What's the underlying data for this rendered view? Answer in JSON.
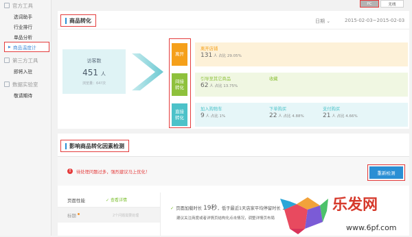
{
  "sidebar": {
    "sections": [
      {
        "title": "官方工具",
        "icon": "shield-icon",
        "items": [
          {
            "label": "选词助手",
            "active": false
          },
          {
            "label": "行业排行",
            "active": false
          },
          {
            "label": "单品分析",
            "active": false
          },
          {
            "label": "商品温度计",
            "active": true
          }
        ]
      },
      {
        "title": "第三方工具",
        "icon": "puzzle-icon",
        "items": [
          {
            "label": "即将入驻",
            "active": false
          }
        ]
      },
      {
        "title": "数据实验室",
        "icon": "flask-icon",
        "items": [
          {
            "label": "敬请期待",
            "active": false
          }
        ]
      }
    ]
  },
  "toolbar": {
    "pc_label": "PC",
    "wireless_label": "无线"
  },
  "conversion": {
    "title": "商品转化",
    "date_label": "日期",
    "date_range": "2015-02-03~2015-02-03",
    "visits": {
      "label": "访客数",
      "value": "451",
      "unit": "人",
      "pv": "浏览量：64?次"
    },
    "categories": [
      {
        "label": "离开",
        "color": "#f5a01a",
        "bg": "#fdf1d8"
      },
      {
        "label": "间接\n转化",
        "color": "#8ec13c",
        "bg": "#f0f7e2"
      },
      {
        "label": "直接\n转化",
        "color": "#4cc2c9",
        "bg": "#e6f6f8"
      }
    ],
    "rows": [
      {
        "metrics": [
          {
            "label": "离开店铺",
            "value": "131",
            "unit": "人",
            "pct": "占比 29.05%"
          }
        ]
      },
      {
        "metrics": [
          {
            "label": "引导至其它商品",
            "value": "62",
            "unit": "人",
            "pct": "占比 13.75%"
          },
          {
            "label": "收藏",
            "value": "",
            "unit": "",
            "pct": ""
          }
        ]
      },
      {
        "metrics": [
          {
            "label": "加入购物车",
            "value": "9",
            "unit": "人",
            "pct": "占比 1%"
          },
          {
            "label": "下单购买",
            "value": "22",
            "unit": "人",
            "pct": "占比 4.88%"
          },
          {
            "label": "支付购买",
            "value": "21",
            "unit": "人",
            "pct": "占比 4.66%"
          }
        ]
      }
    ]
  },
  "factors": {
    "title": "影响商品转化因素检测",
    "warning": "待处理问题过多，强烈建议马上优化！",
    "recheck_label": "重新检测",
    "tabs": [
      {
        "label": "页面性能",
        "status": "查看详情",
        "badge": false
      },
      {
        "label": "标题",
        "status": "2个问题需要处理",
        "badge": true
      }
    ],
    "detail_main_prefix": "页面加载时长",
    "detail_main_value": "19秒",
    "detail_main_suffix": "，低于最近1天店家平均停留时长",
    "detail_main_tail": "10",
    "detail_sub": "建议关注商度或者详情页结构化点击情况，调整详情页布局"
  },
  "watermark": {
    "brand": "乐发网",
    "url": "www.6pf.com"
  }
}
